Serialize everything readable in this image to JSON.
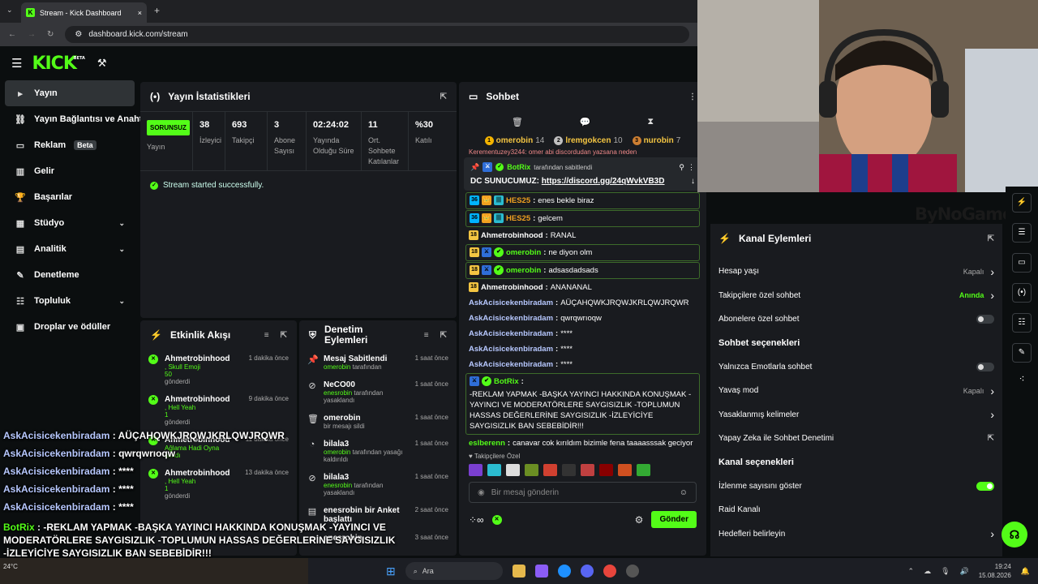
{
  "browser": {
    "tab_title": "Stream - Kick Dashboard",
    "url": "dashboard.kick.com/stream",
    "new_tab": "+",
    "close": "×"
  },
  "header": {
    "logo": "KICK",
    "beta": "BETA"
  },
  "sidebar": [
    {
      "icon": "▸",
      "label": "Yayın",
      "active": true
    },
    {
      "icon": "⛓",
      "label": "Yayın Bağlantısı ve Anahtar"
    },
    {
      "icon": "▭",
      "label": "Reklam",
      "badge": "Beta"
    },
    {
      "icon": "▥",
      "label": "Gelir"
    },
    {
      "icon": "🏆",
      "label": "Başarılar"
    },
    {
      "icon": "▦",
      "label": "Stüdyo",
      "chevron": true
    },
    {
      "icon": "▤",
      "label": "Analitik",
      "chevron": true
    },
    {
      "icon": "✎",
      "label": "Denetleme"
    },
    {
      "icon": "☷",
      "label": "Topluluk",
      "chevron": true
    },
    {
      "icon": "▣",
      "label": "Droplar ve ödüller"
    }
  ],
  "stats": {
    "title": "Yayın İstatistikleri",
    "status": "SORUNSUZ",
    "status_label": "Yayın",
    "cells": [
      {
        "value": "38",
        "label": "İzleyici"
      },
      {
        "value": "693",
        "label": "Takipçi"
      },
      {
        "value": "3",
        "label": "Abone Sayısı"
      },
      {
        "value": "02:24:02",
        "label": "Yayında Olduğu Süre"
      },
      {
        "value": "11",
        "label": "Ort. Sohbete Katılanlar"
      },
      {
        "value": "%30",
        "label": "Katılı"
      }
    ],
    "success": "Stream started successfully."
  },
  "activity": {
    "title": "Etkinlik Akışı",
    "items": [
      {
        "name": "Ahmetrobinhood",
        "line1": ", Skull Emoji",
        "line2": "50",
        "line3": "gönderdi",
        "time": "1 dakika önce"
      },
      {
        "name": "Ahmetrobinhood",
        "line1": ", Hell Yeah",
        "line2": "1",
        "line3": "gönderdi",
        "time": "9 dakika önce"
      },
      {
        "name": "Ahmetrobinhood",
        "line1": "Ağlama Hadi Oyna",
        "line2": "alındı",
        "line3": "",
        "time": "11 dakika önce"
      },
      {
        "name": "Ahmetrobinhood",
        "line1": ", Hell Yeah",
        "line2": "1",
        "line3": "gönderdi",
        "time": "13 dakika önce"
      }
    ]
  },
  "mod": {
    "title": "Denetim Eylemleri",
    "items": [
      {
        "icon": "📌",
        "name": "Mesaj Sabitlendi",
        "who": "omerobin",
        "rest": "tarafından",
        "time": "1 saat önce"
      },
      {
        "icon": "⊘",
        "name": "NeCO00",
        "who": "enesrobin",
        "rest": "tarafından yasaklandı",
        "time": "1 saat önce"
      },
      {
        "icon": "🗑",
        "name": "omerobin",
        "who": "",
        "rest": "bir mesajı sildi",
        "time": "1 saat önce"
      },
      {
        "icon": "◔",
        "name": "bilala3",
        "who": "omerobin",
        "rest": "tarafından yasağı kaldırıldı",
        "time": "1 saat önce"
      },
      {
        "icon": "⊘",
        "name": "bilala3",
        "who": "enesrobin",
        "rest": "tarafından yasaklandı",
        "time": "1 saat önce"
      },
      {
        "icon": "▤",
        "name": "enesrobin bir Anket başlattı",
        "who": "",
        "rest": "",
        "time": "2 saat önce"
      },
      {
        "icon": "⊘",
        "name": "enesrobin",
        "who": "",
        "rest": "",
        "time": "3 saat önce"
      }
    ]
  },
  "chat": {
    "title": "Sohbet",
    "leaders": [
      {
        "rank": "1",
        "name": "omerobin",
        "count": "14",
        "color": "#f4b400"
      },
      {
        "rank": "2",
        "name": "lremgokcen",
        "count": "10",
        "color": "#c0c0c0"
      },
      {
        "rank": "3",
        "name": "nurobin",
        "count": "7",
        "color": "#cd7f32"
      }
    ],
    "hidden_line": "Kerementuzey3244: omer abi discordudan yazsana neden",
    "pinned_by": "BotRix",
    "pinned_suffix": "tarafından sabitlendi",
    "pinned_prefix": "DC SUNUCUMUZ:",
    "pinned_link": "https://discord.gg/24qWvkVB3D",
    "messages": [
      {
        "badges": [
          "36",
          "👑",
          "|||"
        ],
        "user": "HES25",
        "color": "#f0a020",
        "text": "enes bekle biraz",
        "box": true
      },
      {
        "badges": [
          "36",
          "👑",
          "|||"
        ],
        "user": "HES25",
        "color": "#f0a020",
        "text": "gelcem",
        "box": true
      },
      {
        "badges": [
          "18"
        ],
        "user": "Ahmetrobinhood",
        "color": "#ffffff",
        "text": "RANAL",
        "box": false
      },
      {
        "badges": [
          "18",
          "⚔",
          "✔"
        ],
        "user": "omerobin",
        "color": "#53fc18",
        "text": "ne diyon olm",
        "box": true
      },
      {
        "badges": [
          "18",
          "⚔",
          "✔"
        ],
        "user": "omerobin",
        "color": "#53fc18",
        "text": "adsasdadsads",
        "box": true
      },
      {
        "badges": [
          "18"
        ],
        "user": "Ahmetrobinhood",
        "color": "#ffffff",
        "text": "ANANANAL",
        "box": false
      },
      {
        "badges": [],
        "user": "AskAcisicekenbiradam",
        "color": "#b7c8ff",
        "text": "AÜÇAHQWKJRQWJKRLQWJRQWR",
        "box": false
      },
      {
        "badges": [],
        "user": "AskAcisicekenbiradam",
        "color": "#b7c8ff",
        "text": "qwrqwrıoqw",
        "box": false
      },
      {
        "badges": [],
        "user": "AskAcisicekenbiradam",
        "color": "#b7c8ff",
        "text": "****",
        "box": false
      },
      {
        "badges": [],
        "user": "AskAcisicekenbiradam",
        "color": "#b7c8ff",
        "text": "****",
        "box": false
      },
      {
        "badges": [],
        "user": "AskAcisicekenbiradam",
        "color": "#b7c8ff",
        "text": "****",
        "box": false
      },
      {
        "badges": [
          "⚔",
          "✔"
        ],
        "user": "BotRix",
        "color": "#53fc18",
        "text": "-REKLAM YAPMAK -BAŞKA YAYINCI HAKKINDA KONUŞMAK -YAYINCI VE MODERATÖRLERE SAYGISIZLIK -TOPLUMUN HASSAS DEĞERLERİNE SAYGISIZLIK -İZLEYİCİYE SAYGISIZLIK BAN SEBEBİDİR!!!",
        "box": true
      },
      {
        "badges": [],
        "user": "eslberenn",
        "color": "#53fc18",
        "text": "canavar cok kırıldım bizimle fena taaaasssak geciyor",
        "box": false
      }
    ],
    "followers_only": "Takipçilere Özel",
    "input_placeholder": "Bir mesaj gönderin",
    "send": "Gönder"
  },
  "kanal": {
    "title": "Kanal Eylemleri",
    "rows": [
      {
        "type": "row",
        "label": "Hesap yaşı",
        "value": "Kapalı",
        "ctrl": "chevron"
      },
      {
        "type": "row",
        "label": "Takipçilere özel sohbet",
        "value": "Anında",
        "ctrl": "chevron",
        "green": true
      },
      {
        "type": "row",
        "label": "Abonelere özel sohbet",
        "ctrl": "toggle",
        "on": false
      },
      {
        "type": "head",
        "label": "Sohbet seçenekleri"
      },
      {
        "type": "row",
        "label": "Yalnızca Emotlarla sohbet",
        "ctrl": "toggle",
        "on": false
      },
      {
        "type": "row",
        "label": "Yavaş mod",
        "value": "Kapalı",
        "ctrl": "chevron"
      },
      {
        "type": "row",
        "label": "Yasaklanmış kelimeler",
        "ctrl": "chevron"
      },
      {
        "type": "row",
        "label": "Yapay Zeka ile Sohbet Denetimi",
        "ctrl": "external"
      },
      {
        "type": "head",
        "label": "Kanal seçenekleri"
      },
      {
        "type": "row",
        "label": "İzlenme sayısını göster",
        "ctrl": "toggle",
        "on": true
      },
      {
        "type": "row",
        "label": "Raid Kanalı",
        "ctrl": "none"
      },
      {
        "type": "row",
        "label": "Hedefleri belirleyin",
        "ctrl": "chevron"
      }
    ]
  },
  "watermark": "ByNoGame",
  "overlay": [
    {
      "user": "AskAcisicekenbiradam",
      "text": " : AÜÇAHQWKJRQWJKRLQWJRQWR"
    },
    {
      "user": "AskAcisicekenbiradam",
      "text": " : qwrqwrıoqw"
    },
    {
      "user": "AskAcisicekenbiradam",
      "text": " : ****"
    },
    {
      "user": "AskAcisicekenbiradam",
      "text": " : ****"
    },
    {
      "user": "AskAcisicekenbiradam",
      "text": " : ****"
    }
  ],
  "overlay_bot": {
    "user": "BotRix",
    "l1": " : -REKLAM YAPMAK -BAŞKA YAYINCI HAKKINDA KONUŞMAK -YAYINCI VE",
    "l2": "MODERATÖRLERE SAYGISIZLIK -TOPLUMUN HASSAS DEĞERLERİNE SAYGISIZLIK",
    "l3": "-İZLEYİCİYE SAYGISIZLIK BAN SEBEBİDİR!!!"
  },
  "overlay_last": {
    "user": "berenn",
    "text": " : canavar cok kırıldım bizimle fena taaaasssak geciyor"
  },
  "taskbar": {
    "weather": "24°C",
    "search": "Ara",
    "time": "19:24",
    "date": "15.08.2026"
  }
}
